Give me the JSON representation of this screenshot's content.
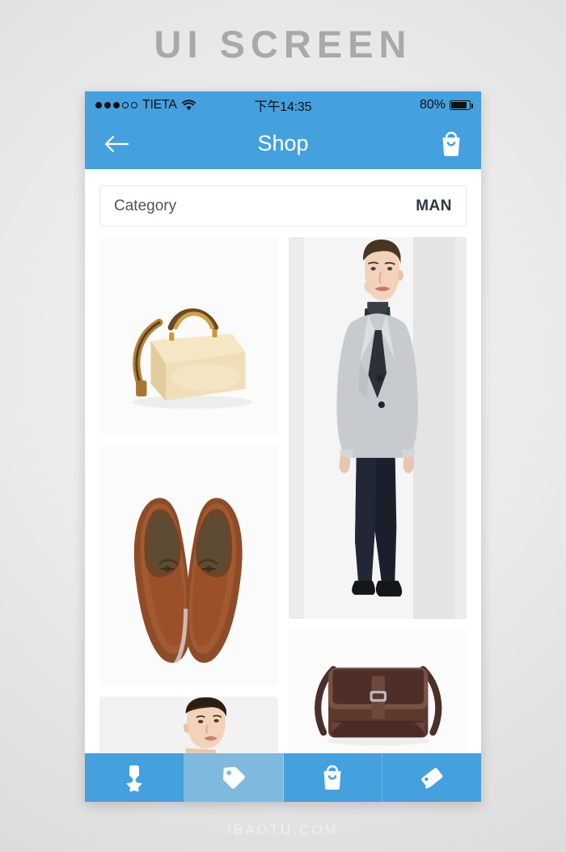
{
  "page": {
    "caption": "UI SCREEN",
    "watermark": "IBAOTU.COM",
    "accent_color": "#45a0de",
    "accent_active_color": "#7fb9de",
    "background_color": "#e8e8e8"
  },
  "status_bar": {
    "signal_dots_filled": 3,
    "signal_dots_empty": 2,
    "carrier": "TIETA",
    "wifi_icon": "wifi-icon",
    "time": "下午14:35",
    "battery_percent": "80%",
    "battery_level": 80
  },
  "nav_bar": {
    "back_icon": "arrow-left-icon",
    "title": "Shop",
    "cart_icon": "shopping-bag-icon"
  },
  "category_bar": {
    "label": "Category",
    "value": "MAN"
  },
  "products": {
    "left_column": [
      {
        "name": "handbag",
        "alt": "Cream leather handbag with brown straps"
      },
      {
        "name": "dress-shoes",
        "alt": "Pair of brown leather derby shoes"
      },
      {
        "name": "model-portrait",
        "alt": "Portrait of young male model"
      }
    ],
    "right_column": [
      {
        "name": "suit-model",
        "alt": "Male model in grey blazer and black trousers"
      },
      {
        "name": "messenger-bag",
        "alt": "Dark brown leather messenger bag"
      }
    ]
  },
  "tab_bar": {
    "items": [
      {
        "name": "tab-rewards",
        "icon": "medal-icon",
        "active": false
      },
      {
        "name": "tab-shop",
        "icon": "price-tag-icon",
        "active": true
      },
      {
        "name": "tab-cart",
        "icon": "shopping-bag-icon",
        "active": false
      },
      {
        "name": "tab-cards",
        "icon": "card-icon",
        "active": false
      }
    ]
  }
}
